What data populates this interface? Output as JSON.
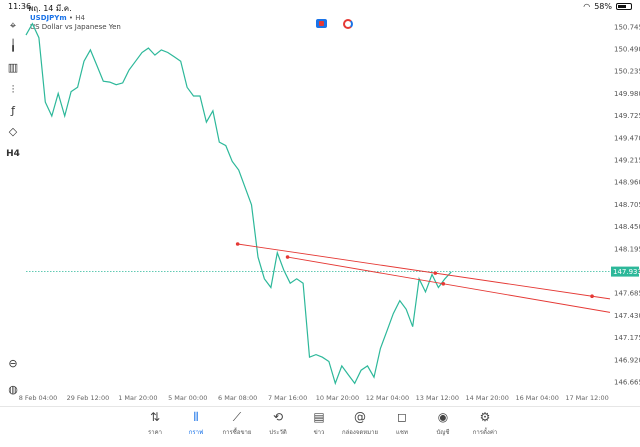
{
  "status_bar": {
    "time": "11:36",
    "date": "พฤ. 14 มี.ค.",
    "battery": "58%"
  },
  "header": {
    "symbol": "USDJPYm",
    "timeframe": "H4",
    "description": "US Dollar vs Japanese Yen"
  },
  "toolbar": {
    "items": [
      {
        "name": "crosshair-icon",
        "glyph": "⌖"
      },
      {
        "name": "candlestick-icon",
        "glyph": "╽"
      },
      {
        "name": "bar-chart-icon",
        "glyph": "▥"
      },
      {
        "name": "settings-sliders-icon",
        "glyph": "⫶"
      },
      {
        "name": "function-icon",
        "glyph": "ƒ"
      },
      {
        "name": "shapes-icon",
        "glyph": "◇"
      },
      {
        "name": "timeframe-label",
        "glyph": "H4"
      },
      {
        "name": "zoom-icon",
        "glyph": "⊖"
      },
      {
        "name": "app-logo-icon",
        "glyph": "◍"
      }
    ]
  },
  "chart_data": {
    "type": "line",
    "symbol": "USDJPYm",
    "timeframe": "H4",
    "current_price": "147.933",
    "y_ticks": [
      "150.745",
      "150.490",
      "150.235",
      "149.980",
      "149.725",
      "149.470",
      "149.215",
      "148.960",
      "148.705",
      "148.450",
      "148.195",
      "147.940",
      "147.685",
      "147.430",
      "147.175",
      "146.920",
      "146.665"
    ],
    "x_ticks": [
      "8 Feb 04:00",
      "29 Feb 12:00",
      "1 Mar 20:00",
      "5 Mar 00:00",
      "6 Mar 08:00",
      "7 Mar 16:00",
      "10 Mar 20:00",
      "12 Mar 04:00",
      "13 Mar 12:00",
      "14 Mar 20:00",
      "16 Mar 04:00",
      "17 Mar 12:00"
    ],
    "ylim": [
      146.55,
      150.8
    ],
    "series": [
      {
        "values": [
          150.65,
          150.78,
          150.62,
          149.88,
          149.72,
          149.98,
          149.72,
          150.0,
          150.05,
          150.35,
          150.48,
          150.3,
          150.12,
          150.11,
          150.08,
          150.1,
          150.25,
          150.35,
          150.45,
          150.5,
          150.42,
          150.48,
          150.45,
          150.4,
          150.35,
          150.05,
          149.95,
          149.95,
          149.65,
          149.78,
          149.42,
          149.38,
          149.2,
          149.1,
          148.9,
          148.7,
          148.1,
          147.85,
          147.75,
          148.15,
          147.95,
          147.8,
          147.85,
          147.8,
          146.95,
          146.98,
          146.95,
          146.9,
          146.65,
          146.85,
          146.75,
          146.65,
          146.8,
          146.85,
          146.72,
          147.05,
          147.25,
          147.45,
          147.6,
          147.5,
          147.3,
          147.85,
          147.7,
          147.9,
          147.75,
          147.85,
          147.93
        ]
      }
    ],
    "trendlines": [
      {
        "start": [
          "6 Mar 08:00",
          148.25
        ],
        "end": [
          "17 Mar 12:00",
          147.65
        ]
      },
      {
        "start": [
          "7 Mar 16:00",
          148.1
        ],
        "end": [
          "17 Mar 12:00",
          147.5
        ]
      }
    ],
    "colors": {
      "line": "#2db89a",
      "trendline": "#e53935",
      "price_line": "#2db89a",
      "price_label_bg": "#2db89a"
    }
  },
  "bottom_nav": {
    "items": [
      {
        "name": "nav-quotes",
        "icon": "⇅",
        "label": "ราคา",
        "active": false
      },
      {
        "name": "nav-chart",
        "icon": "⦀",
        "label": "กราฟ",
        "active": true
      },
      {
        "name": "nav-trade",
        "icon": "⟋",
        "label": "การซื้อขาย",
        "active": false
      },
      {
        "name": "nav-history",
        "icon": "⟲",
        "label": "ประวัติ",
        "active": false
      },
      {
        "name": "nav-news",
        "icon": "▤",
        "label": "ข่าว",
        "active": false
      },
      {
        "name": "nav-mailbox",
        "icon": "@",
        "label": "กล่องจดหมาย",
        "active": false
      },
      {
        "name": "nav-chat",
        "icon": "◻",
        "label": "แชท",
        "active": false
      },
      {
        "name": "nav-account",
        "icon": "◉",
        "label": "บัญชี",
        "active": false
      },
      {
        "name": "nav-settings",
        "icon": "⚙",
        "label": "การตั้งค่า",
        "active": false
      }
    ]
  }
}
